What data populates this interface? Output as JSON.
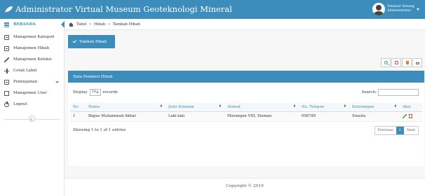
{
  "header": {
    "title": "Administrator Virtual Museum Geoteknologi Mineral",
    "user_greeting": "Selamat Datang",
    "user_role": "Administrator"
  },
  "sidebar": {
    "items": [
      {
        "label": "BERANDA",
        "icon": "bank-icon"
      },
      {
        "label": "Manajemen Kategori",
        "icon": "list-icon"
      },
      {
        "label": "Manajemen Hibah",
        "icon": "list-icon"
      },
      {
        "label": "Manajemen Koleksi",
        "icon": "pencil-icon"
      },
      {
        "label": "Cetak Label",
        "icon": "move-icon"
      },
      {
        "label": "Peminjaman",
        "icon": "list-icon"
      },
      {
        "label": "Manajemen User",
        "icon": "edit-icon"
      },
      {
        "label": "Logout",
        "icon": "power-icon"
      }
    ]
  },
  "breadcrumb": {
    "items": [
      "Tabel",
      "Hibah",
      "Tambah Hibah"
    ],
    "separator": ">"
  },
  "actions": {
    "add_label": "Tambah Hibah"
  },
  "panel": {
    "title": "Data Pemberi Hibah",
    "display_label": "Display",
    "records_label": "records",
    "page_size": "10",
    "search_label": "Search:",
    "search_value": ""
  },
  "table": {
    "headers": [
      "No",
      "Nama",
      "Jenis Kelamin",
      "Alamat",
      "No. Telepon",
      "Keterangan",
      "Aksi"
    ],
    "rows": [
      [
        "1",
        "Bagus Muhammad Akbar",
        "Laki-laki",
        "Murangan VIII, Sleman",
        "098789",
        "Swasta"
      ]
    ]
  },
  "pagination": {
    "summary": "Showing 1 to 1 of 1 entries",
    "previous": "Previous",
    "current": "1",
    "next": "Next"
  },
  "footer": {
    "text": "Copyright © 2019"
  },
  "colors": {
    "primary": "#3c8dbc"
  }
}
